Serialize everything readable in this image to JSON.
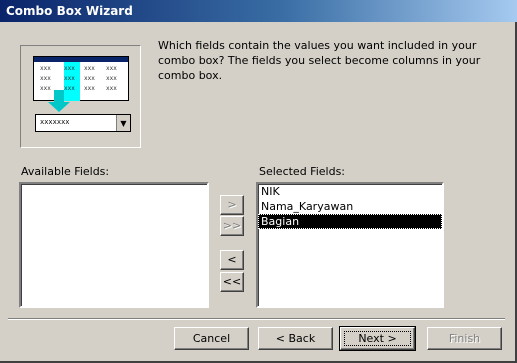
{
  "window": {
    "title": "Combo Box Wizard"
  },
  "illustration": {
    "icon": "combo-box-illustration",
    "cell_text": "xxx",
    "combo_text": "xxxxxxx"
  },
  "instructions": "Which fields contain the values you want included in your combo box? The fields you select become columns in your combo box.",
  "available": {
    "label": "Available Fields:",
    "items": []
  },
  "selected": {
    "label": "Selected Fields:",
    "items": [
      "NIK",
      "Nama_Karyawan",
      "Bagian"
    ],
    "selected_index": 2
  },
  "move_buttons": {
    "add": ">",
    "add_all": ">>",
    "remove": "<",
    "remove_all": "<<"
  },
  "buttons": {
    "cancel": "Cancel",
    "back": "< Back",
    "next": "Next >",
    "finish": "Finish"
  },
  "colors": {
    "title_start": "#0a246a",
    "title_end": "#a6caf0",
    "highlight": "#00ffff",
    "arrow": "#00c8c8"
  }
}
